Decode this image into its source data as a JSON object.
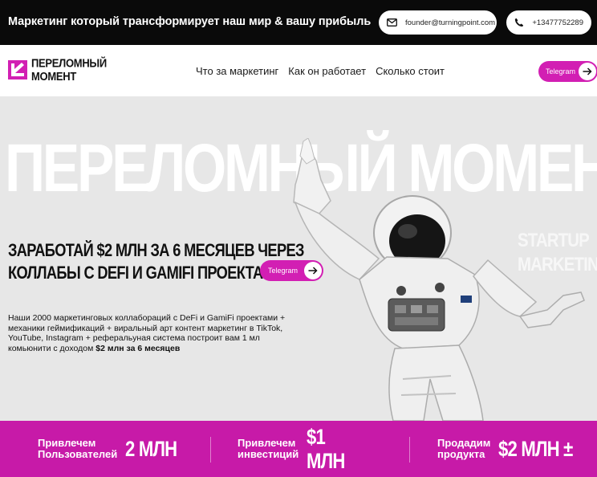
{
  "topbar": {
    "tagline": "Маркетинг который трансформирует наш мир & вашу прибыль",
    "email": "founder@turningpoint.com",
    "phone": "+13477752289"
  },
  "nav": {
    "logo_line1": "ПЕРЕЛОМНЫЙ",
    "logo_line2": "МОМЕНТ",
    "links": [
      "Что за маркетинг",
      "Как он работает",
      "Сколько стоит"
    ],
    "cta": "Telegram"
  },
  "hero": {
    "bigword": "ПЕРЕЛОМНЫЙ МОМЕНТ",
    "side_line1": "STARTUP",
    "side_line2": "MARKETING",
    "title_line1": "ЗАРАБОТАЙ $2 МЛН ЗА 6 МЕСЯЦЕВ ЧЕРЕЗ",
    "title_line2": "КОЛЛАБЫ С DEFI И GAMIFI ПРОЕКТАМИ",
    "text_plain": "Наши 2000 маркетинговых коллабораций с DeFi и GamiFi проектами + механики геймификаций + виральный арт контент маркетинг в TikTok, YouTube, Instagram + реферальуная система построит вам 1 мл комьюнити с доходом ",
    "text_bold": "$2 млн за 6 месяцев",
    "cta": "Telegram"
  },
  "stats": [
    {
      "label_line1": "Привлечем",
      "label_line2": "Пользователей",
      "value": "2 МЛН"
    },
    {
      "label_line1": "Привлечем",
      "label_line2": "инвестиций",
      "value_line1": "$1",
      "value_line2": "МЛН"
    },
    {
      "label_line1": "Продадим",
      "label_line2": "продукта",
      "value": "$2 МЛН ±"
    }
  ],
  "colors": {
    "accent": "#c71aa8",
    "dark": "#0a0a0a"
  },
  "icons": [
    "mail-icon",
    "phone-icon",
    "arrow-right-icon",
    "logo-mark"
  ]
}
